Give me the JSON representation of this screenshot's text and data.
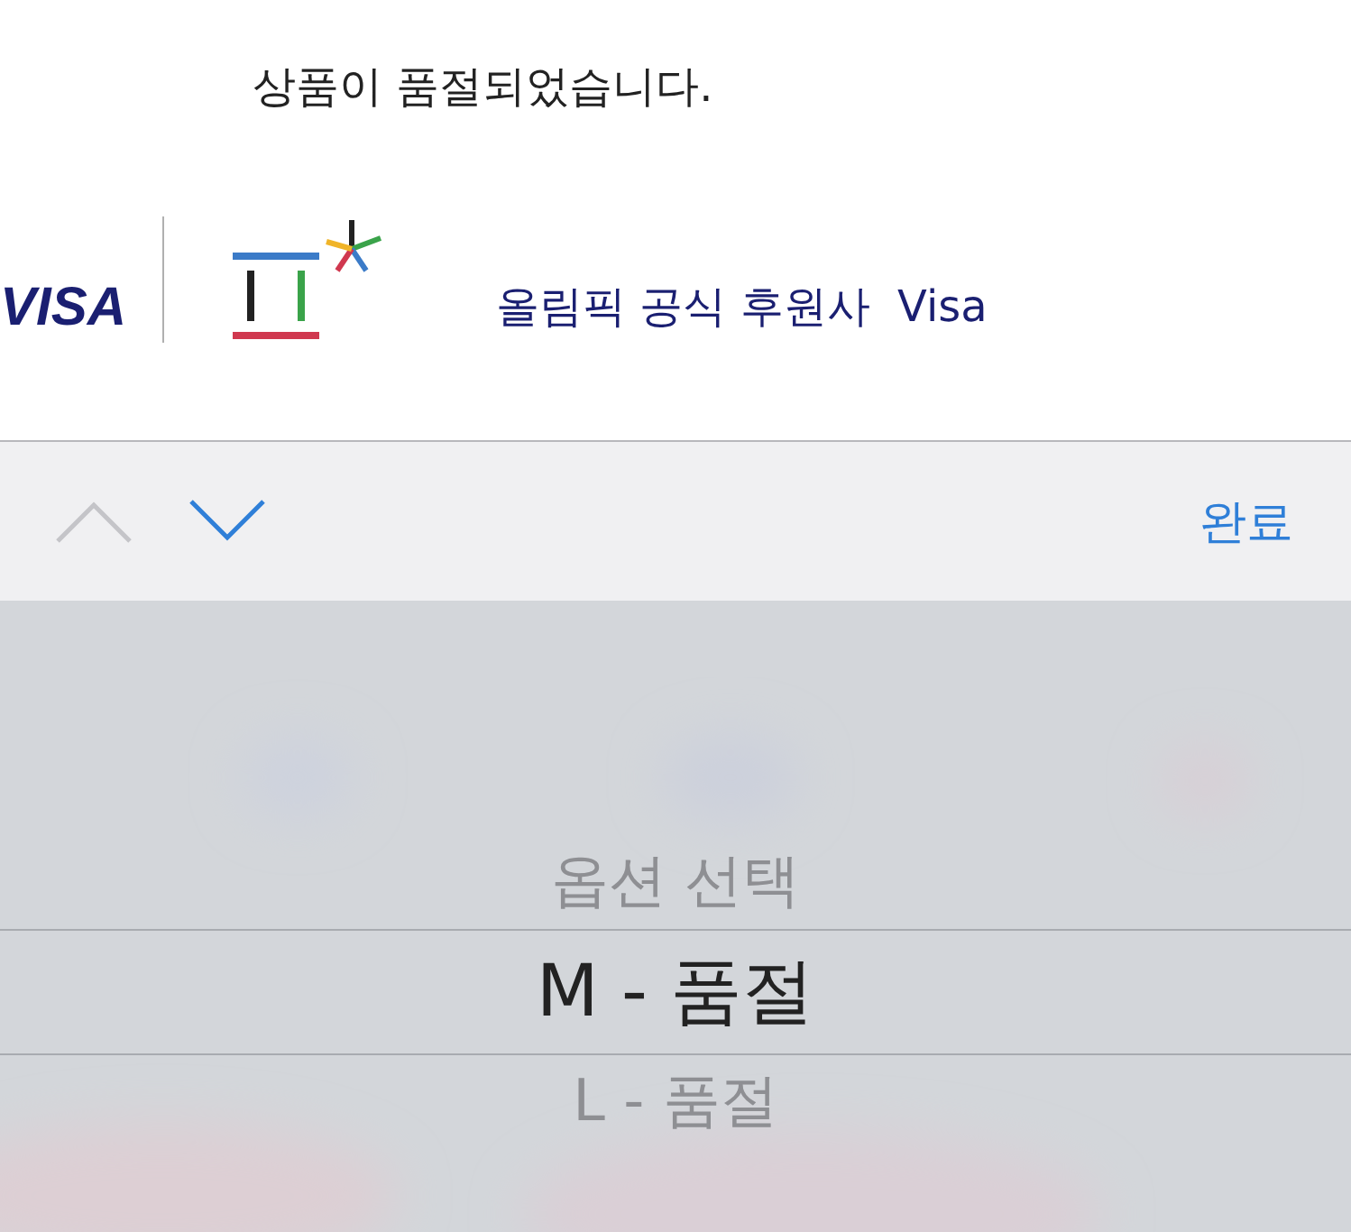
{
  "message": "상품이 품절되었습니다.",
  "banner": {
    "brand": "VISA",
    "text": "올림픽 공식 후원사  Visa"
  },
  "toolbar": {
    "previous": {
      "disabled": true
    },
    "next": {
      "disabled": false
    },
    "done": "완료"
  },
  "picker": {
    "options": [
      {
        "label": "옵션 선택",
        "selected": false
      },
      {
        "label": "M - 품절",
        "selected": true
      },
      {
        "label": "L - 품절",
        "selected": false
      }
    ]
  }
}
